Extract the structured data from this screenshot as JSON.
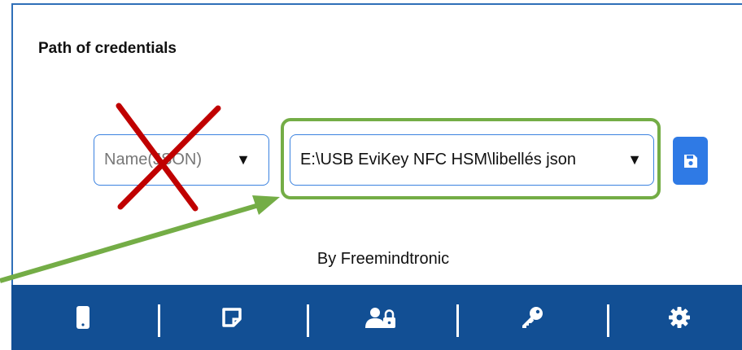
{
  "section": {
    "title": "Path of credentials"
  },
  "json_select": {
    "placeholder": "Name(JSON)",
    "caret": "▼"
  },
  "path_select": {
    "value": "E:\\USB EviKey NFC HSM\\libellés json",
    "caret": "▼"
  },
  "save_button": {
    "icon": "floppy-disk-icon"
  },
  "footer": {
    "byline": "By Freemindtronic"
  },
  "bottom_nav": [
    {
      "icon": "phone-icon"
    },
    {
      "icon": "note-icon"
    },
    {
      "icon": "user-lock-icon"
    },
    {
      "icon": "key-icon"
    },
    {
      "icon": "gear-icon"
    }
  ],
  "annotations": {
    "cross_color": "#c00000",
    "highlight_color": "#74ad46"
  },
  "colors": {
    "accent": "#2f7ae5",
    "navbar": "#124f94",
    "border": "#3b82e0"
  }
}
